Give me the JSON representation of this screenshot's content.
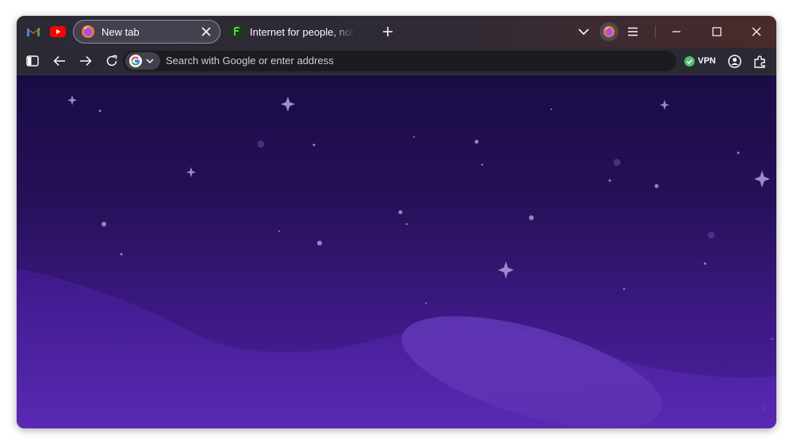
{
  "tabs": {
    "pinned": [
      {
        "name": "gmail-icon"
      },
      {
        "name": "youtube-icon"
      }
    ],
    "active": {
      "title": "New tab",
      "favicon": "firefox-icon"
    },
    "inactive": {
      "title": "Internet for people, not profit",
      "favicon": "mozilla-icon"
    }
  },
  "toolbar_icons": {
    "list_all_tabs": "chevron-down-icon",
    "account": "firefox-account-icon",
    "menu": "hamburger-menu-icon",
    "minimize": "minimize-icon",
    "maximize": "maximize-icon",
    "close": "close-icon"
  },
  "navbar": {
    "search_placeholder": "Search with Google or enter address",
    "engine": "google-icon",
    "vpn_label": "VPN"
  },
  "colors": {
    "accent": "#8f8fb0",
    "vpn_status": "#50c070",
    "background_top": "#1a0b45",
    "background_bottom": "#4b22a0"
  }
}
